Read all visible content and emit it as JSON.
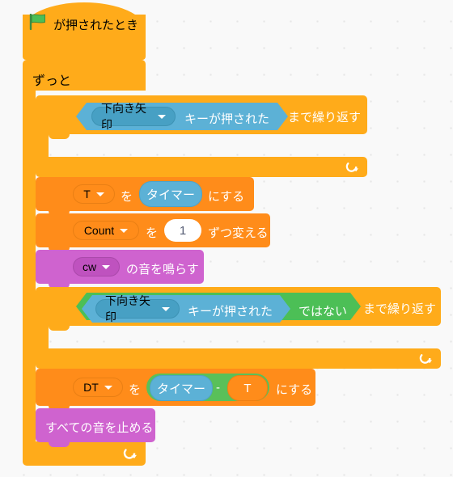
{
  "program": {
    "language": "ja",
    "title": "Scratch block script",
    "palette_colors": {
      "events": "#FFAB1A",
      "control": "#FFAB1A",
      "variables": "#FF8C1A",
      "sound": "#CF63CF",
      "sensing": "#5CB1D6",
      "operators": "#59C059",
      "canvas_background": "#F9F9F9"
    }
  },
  "blocks": {
    "hat": {
      "icon": "green-flag-icon",
      "label": "が押されたとき"
    },
    "forever": {
      "label": "ずっと",
      "loop_arrow": "loop-arrow-icon"
    },
    "repeat_until_1": {
      "condition_dropdown": "下向き矢印",
      "condition_text": "キーが押された",
      "until_label": "まで繰り返す",
      "loop_arrow": "loop-arrow-icon"
    },
    "set_t": {
      "variable": "T",
      "connector": "を",
      "value": "タイマー",
      "suffix": "にする"
    },
    "change_count": {
      "variable": "Count",
      "connector": "を",
      "value": "1",
      "suffix": "ずつ変える"
    },
    "play_sound": {
      "sound": "cw",
      "suffix": "の音を鳴らす"
    },
    "repeat_until_2": {
      "condition_dropdown": "下向き矢印",
      "condition_text": "キーが押された",
      "not_label": "ではない",
      "until_label": "まで繰り返す",
      "loop_arrow": "loop-arrow-icon"
    },
    "set_dt": {
      "variable": "DT",
      "connector": "を",
      "operand_left": "タイマー",
      "operator": "-",
      "operand_right": "T",
      "suffix": "にする"
    },
    "stop_all_sounds": {
      "label": "すべての音を止める"
    }
  }
}
